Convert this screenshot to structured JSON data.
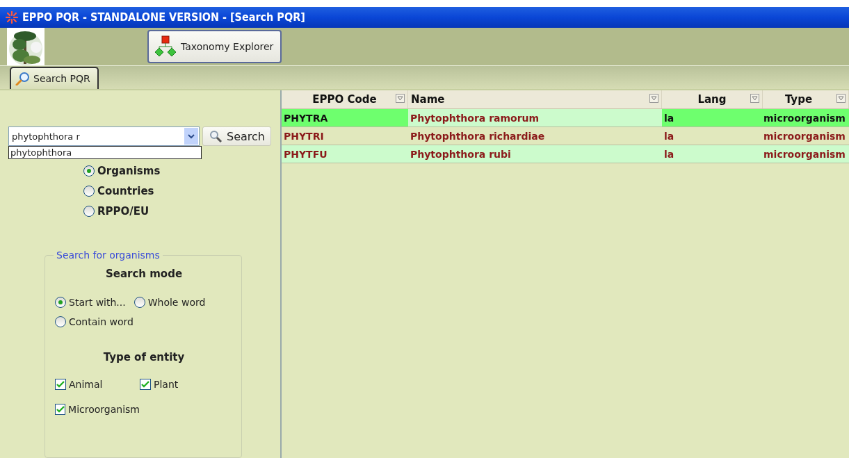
{
  "window": {
    "title": "EPPO PQR - STANDALONE VERSION - [Search PQR]"
  },
  "toolbar": {
    "buttons": [
      {
        "label": "Taxonomy Explorer"
      }
    ]
  },
  "tabs": [
    {
      "label": "Search PQR",
      "selected": true
    }
  ],
  "search": {
    "value": "phytophthora r",
    "suggestions": [
      "phytophthora"
    ],
    "button": "Search"
  },
  "scope": [
    {
      "label": "Organisms",
      "selected": true
    },
    {
      "label": "Countries",
      "selected": false
    },
    {
      "label": "RPPO/EU",
      "selected": false
    }
  ],
  "organism_search": {
    "legend": "Search for organisms",
    "mode_title": "Search mode",
    "modes": [
      {
        "label": "Start with...",
        "selected": true
      },
      {
        "label": "Whole word",
        "selected": false
      },
      {
        "label": "Contain word",
        "selected": false
      }
    ],
    "entity_title": "Type of entity",
    "entities": [
      {
        "label": "Animal",
        "checked": true
      },
      {
        "label": "Plant",
        "checked": true
      },
      {
        "label": "Microorganism",
        "checked": true
      }
    ]
  },
  "table": {
    "columns": [
      "EPPO Code",
      "Name",
      "Lang",
      "Type"
    ],
    "rows": [
      {
        "cells": [
          "PHYTRA",
          "Phytophthora ramorum",
          "la",
          "microorganism"
        ],
        "selected": true
      },
      {
        "cells": [
          "PHYTRI",
          "Phytophthora richardiae",
          "la",
          "microorganism"
        ],
        "selected": false
      },
      {
        "cells": [
          "PHYTFU",
          "Phytophthora rubi",
          "la",
          "microorganism"
        ],
        "selected": false
      }
    ]
  }
}
